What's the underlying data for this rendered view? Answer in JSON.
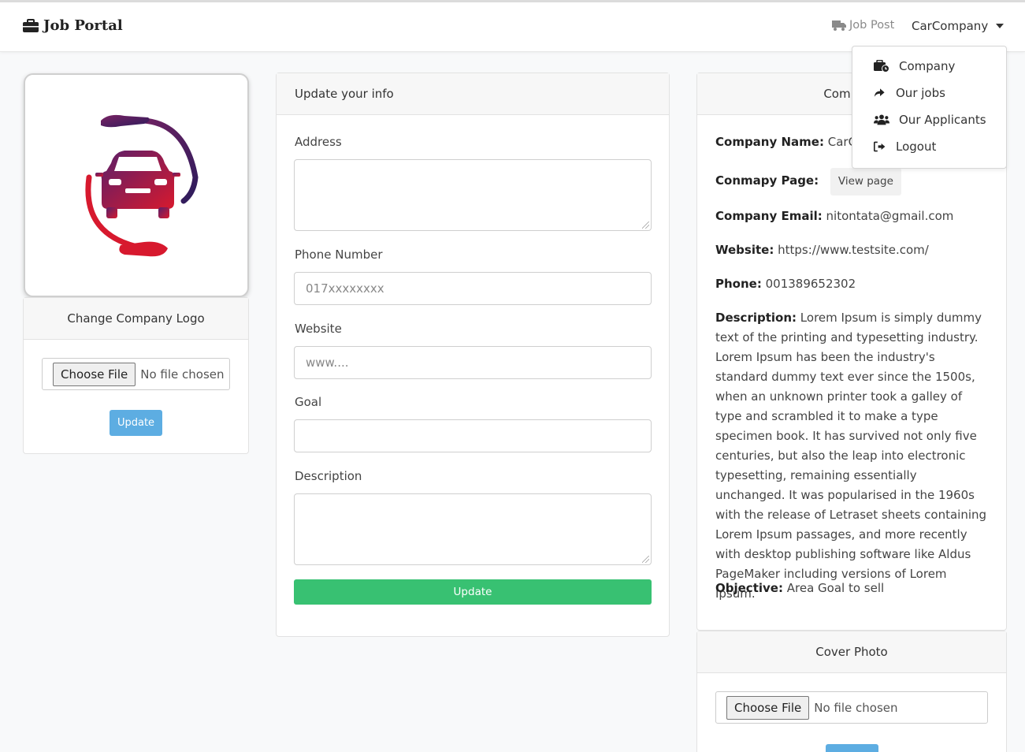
{
  "navbar": {
    "brand": "Job Portal",
    "job_post": "Job Post",
    "user_menu": "CarCompany"
  },
  "dropdown": {
    "items": [
      {
        "label": "Company",
        "icon": "user-tie-icon"
      },
      {
        "label": "Our jobs",
        "icon": "share-icon"
      },
      {
        "label": "Our Applicants",
        "icon": "users-icon"
      },
      {
        "label": "Logout",
        "icon": "sign-out-icon"
      }
    ]
  },
  "logo_card": {
    "header": "Change Company Logo",
    "file_button": "Choose File",
    "file_status": "No file chosen",
    "update": "Update"
  },
  "form": {
    "title": "Update your info",
    "address_label": "Address",
    "address_value": "",
    "phone_label": "Phone Number",
    "phone_placeholder": "017xxxxxxxx",
    "website_label": "Website",
    "website_placeholder": "www....",
    "goal_label": "Goal",
    "goal_value": "",
    "description_label": "Description",
    "description_value": "",
    "submit": "Update"
  },
  "company_info": {
    "header": "Company",
    "name_label": "Company Name:",
    "name_value": "CarCompany",
    "page_label": "Conmapy Page:",
    "page_button": "View page",
    "email_label": "Company Email:",
    "email_value": "nitontata@gmail.com",
    "website_label": "Website:",
    "website_value": "https://www.testsite.com/",
    "phone_label": "Phone:",
    "phone_value": "001389652302",
    "description_label": "Description:",
    "description_value": "Lorem Ipsum is simply dummy text of the printing and typesetting industry. Lorem Ipsum has been the industry's standard dummy text ever since the 1500s, when an unknown printer took a galley of type and scrambled it to make a type specimen book. It has survived not only five centuries, but also the leap into electronic typesetting, remaining essentially unchanged. It was popularised in the 1960s with the release of Letraset sheets containing Lorem Ipsum passages, and more recently with desktop publishing software like Aldus PageMaker including versions of Lorem Ipsum.",
    "objective_label": "Objective:",
    "objective_value": "Area Goal to sell"
  },
  "cover_card": {
    "header": "Cover Photo",
    "file_button": "Choose File",
    "file_status": "No file chosen"
  },
  "colors": {
    "green": "#38c172",
    "blue": "#5dade2",
    "logo_red": "#d7192e",
    "logo_purple": "#3a1c5c"
  }
}
